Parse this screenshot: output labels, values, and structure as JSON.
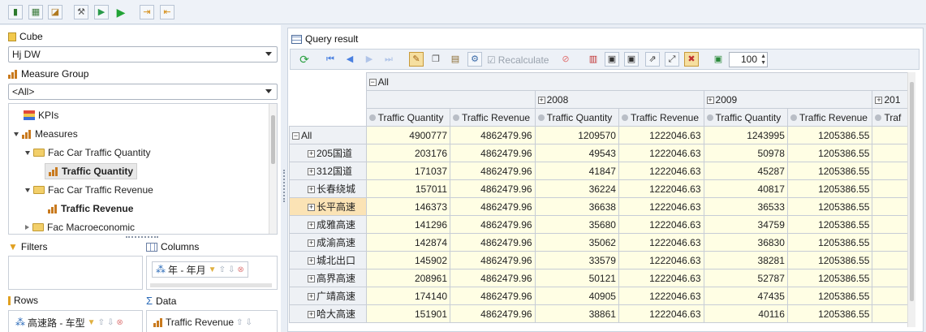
{
  "toolbar_icons": [
    "new-icon",
    "open-icon",
    "chart-icon",
    "design-icon",
    "run-mode-icon",
    "play-icon",
    "export-icon",
    "import-icon"
  ],
  "left": {
    "cube_label": "Cube",
    "cube_value": "Hj DW",
    "measure_group_label": "Measure Group",
    "measure_group_value": "<All>",
    "tree": {
      "kpis": "KPIs",
      "measures": "Measures",
      "fac_qty": "Fac Car Traffic Quantity",
      "traffic_qty": "Traffic Quantity",
      "fac_rev": "Fac Car Traffic Revenue",
      "traffic_rev": "Traffic Revenue",
      "fac_macro": "Fac Macroeconomic"
    },
    "filters_label": "Filters",
    "columns_label": "Columns",
    "columns_chip": "年 - 年月",
    "rows_label": "Rows",
    "rows_chip": "高速路 - 车型",
    "data_label": "Data",
    "data_chip": "Traffic Revenue"
  },
  "query": {
    "title": "Query result",
    "recalculate": "Recalculate",
    "page_size": "100"
  },
  "grid": {
    "all_col": "All",
    "years": [
      "2008",
      "2009",
      "201"
    ],
    "headers": [
      "Traffic Quantity",
      "Traffic Revenue",
      "Traffic Quantity",
      "Traffic Revenue",
      "Traffic Quantity",
      "Traffic Revenue",
      "Traf"
    ],
    "rows": [
      {
        "label": "All",
        "vals": [
          "4900777",
          "4862479.96",
          "1209570",
          "1222046.63",
          "1243995",
          "1205386.55"
        ]
      },
      {
        "label": "205国道",
        "vals": [
          "203176",
          "4862479.96",
          "49543",
          "1222046.63",
          "50978",
          "1205386.55"
        ]
      },
      {
        "label": "312国道",
        "vals": [
          "171037",
          "4862479.96",
          "41847",
          "1222046.63",
          "45287",
          "1205386.55"
        ]
      },
      {
        "label": "长春绕城",
        "vals": [
          "157011",
          "4862479.96",
          "36224",
          "1222046.63",
          "40817",
          "1205386.55"
        ]
      },
      {
        "label": "长平高速",
        "vals": [
          "146373",
          "4862479.96",
          "36638",
          "1222046.63",
          "36533",
          "1205386.55"
        ]
      },
      {
        "label": "成雅高速",
        "vals": [
          "141296",
          "4862479.96",
          "35680",
          "1222046.63",
          "34759",
          "1205386.55"
        ]
      },
      {
        "label": "成渝高速",
        "vals": [
          "142874",
          "4862479.96",
          "35062",
          "1222046.63",
          "36830",
          "1205386.55"
        ]
      },
      {
        "label": "城北出口",
        "vals": [
          "145902",
          "4862479.96",
          "33579",
          "1222046.63",
          "38281",
          "1205386.55"
        ]
      },
      {
        "label": "高界高速",
        "vals": [
          "208961",
          "4862479.96",
          "50121",
          "1222046.63",
          "52787",
          "1205386.55"
        ]
      },
      {
        "label": "广靖高速",
        "vals": [
          "174140",
          "4862479.96",
          "40905",
          "1222046.63",
          "47435",
          "1205386.55"
        ]
      },
      {
        "label": "哈大高速",
        "vals": [
          "151901",
          "4862479.96",
          "38861",
          "1222046.63",
          "40116",
          "1205386.55"
        ]
      }
    ]
  },
  "colors": {
    "accent": "#f6dfa0",
    "cell_bg": "#fffee4",
    "header_bg": "#eef1f5"
  }
}
